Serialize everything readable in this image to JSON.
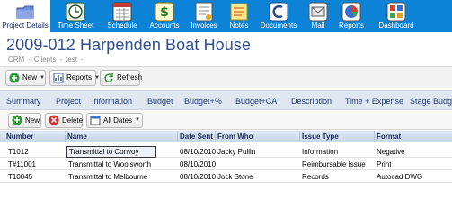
{
  "nav": {
    "items": [
      {
        "label": "Project Details",
        "icon": "folder-icon",
        "active": true
      },
      {
        "label": "Time Sheet",
        "icon": "clock-icon",
        "active": false
      },
      {
        "label": "Schedule",
        "icon": "calendar-icon",
        "active": false
      },
      {
        "label": "Accounts",
        "icon": "dollar-icon",
        "active": false
      },
      {
        "label": "Invoices",
        "icon": "invoice-icon",
        "active": false
      },
      {
        "label": "Notes",
        "icon": "notes-icon",
        "active": false
      },
      {
        "label": "Documents",
        "icon": "documents-icon",
        "active": false
      },
      {
        "label": "Mail",
        "icon": "mail-icon",
        "active": false
      },
      {
        "label": "Reports",
        "icon": "reports-icon",
        "active": false
      },
      {
        "label": "Dashboard",
        "icon": "dashboard-icon",
        "active": false
      }
    ]
  },
  "page": {
    "title": "2009-012 Harpenden Boat House",
    "breadcrumb": [
      "CRM",
      "-",
      "Clients",
      "-",
      "test",
      "-"
    ]
  },
  "toolbar": {
    "new_label": "New",
    "reports_label": "Reports",
    "refresh_label": "Refresh"
  },
  "tabs": [
    "Summary",
    "Project",
    "Information",
    "Budget",
    "Budget+%",
    "Budget+CA",
    "Description",
    "Time + Expense",
    "Stage Budg"
  ],
  "grid_toolbar": {
    "new_label": "New",
    "delete_label": "Delete",
    "filter_value": "All Dates"
  },
  "grid": {
    "columns": [
      "Number",
      "Name",
      "Date Sent",
      "From Who",
      "Issue Type",
      "Format"
    ],
    "rows": [
      [
        "T1012",
        "Transmittal to Convoy",
        "08/10/2010",
        "Jacky Pullin",
        "Information",
        "Negative"
      ],
      [
        "T#11001",
        "Transmittal to Woolsworth",
        "08/10/2010",
        "",
        "Reimbursable Issue",
        "Print"
      ],
      [
        "T10045",
        "Transmittal to Melbourne",
        "08/10/2010",
        "Jock Stone",
        "Records",
        "Autocad DWG"
      ]
    ]
  },
  "colors": {
    "nav_bg": "#0d83d8",
    "title": "#2f4f8f",
    "tab_text": "#1f3a78",
    "tab_bg": "#dfe7f1",
    "grid_header": "#c9d7ea"
  }
}
